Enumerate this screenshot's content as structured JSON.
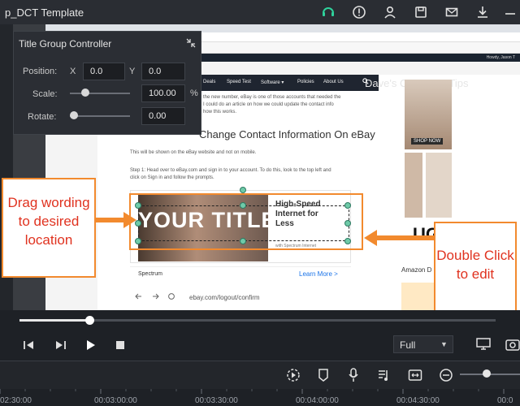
{
  "app": {
    "title": "p_DCT Template",
    "titlebar_icons": [
      "headset-icon",
      "info-icon",
      "account-icon",
      "save-icon",
      "mail-icon",
      "download-icon"
    ]
  },
  "panel": {
    "title": "Title Group Controller",
    "position_label": "Position:",
    "x_label": "X",
    "x_value": "0.0",
    "y_label": "Y",
    "y_value": "0.0",
    "scale_label": "Scale:",
    "scale_value": "100.00",
    "scale_unit": "%",
    "rotate_label": "Rotate:",
    "rotate_value": "0.00"
  },
  "browser": {
    "account_text": "Howdy, Jason T",
    "nav": [
      "Deals",
      "Speed Test",
      "Software ▾",
      "Policies",
      "About Us"
    ],
    "brand": "Dave's Computer Tips",
    "heading": "Change Contact Information On eBay",
    "ad_title": [
      "High-Speed",
      "Internet for",
      "Less"
    ],
    "ad_sub": "with Spectrum Internet",
    "ad_sponsor": "Spectrum",
    "ad_cta": "Learn More >",
    "url": "ebay.com/logout/confirm",
    "side_shop": "SHOP NOW",
    "side_brand": "UG",
    "side_label": "Amazon D",
    "paragraphs": [
      "the new number, eBay is one of those accounts that needed the",
      "I could do an article on how we could update the contact info",
      "how this works.",
      "This will be shown on the eBay website and not on mobile.",
      "Step 1: Head over to eBay.com and sign in to your account. To do this, look to the top left and",
      "click on Sign in and follow the prompts."
    ]
  },
  "overlay": {
    "title_text": "YOUR TITLE"
  },
  "annotations": {
    "drag": "Drag wording to desired location",
    "double": "Double Click to edit",
    "accent": "#f28a2e",
    "text_color": "#e0321f"
  },
  "player": {
    "progress": 0.146,
    "quality": "Full"
  },
  "timeline": {
    "ticks": [
      "02:30:00",
      "00:03:00:00",
      "00:03:30:00",
      "00:04:00:00",
      "00:04:30:00",
      "00:0"
    ]
  },
  "zoom": {
    "level": 0.45
  }
}
